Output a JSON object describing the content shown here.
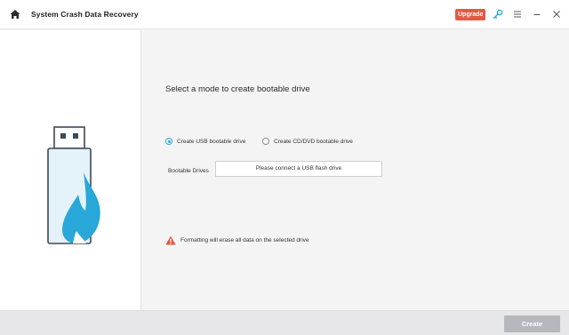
{
  "window": {
    "title": "System Crash Data Recovery",
    "upgrade_label": "Upgrade"
  },
  "icons": {
    "home": "home-icon",
    "key": "key-icon",
    "menu": "menu-icon",
    "minimize": "minimize-icon",
    "close": "close-icon",
    "illustration": "usb-drive-icon",
    "warning": "warning-icon"
  },
  "colors": {
    "accent": "#27a8d8",
    "upgrade": "#e25a44",
    "warning": "#e25a44",
    "create_disabled": "#b6b8bd"
  },
  "main": {
    "heading": "Select a mode to create bootable drive",
    "modes": [
      {
        "label": "Create USB bootable drive",
        "selected": true
      },
      {
        "label": "Create CD/DVD bootable drive",
        "selected": false
      }
    ],
    "drives_label": "Bootable Drives",
    "drives_value": "Please connect a USB flash drive",
    "warning_text": "Formatting will erase all data on the selected drive"
  },
  "footer": {
    "create_label": "Create"
  }
}
